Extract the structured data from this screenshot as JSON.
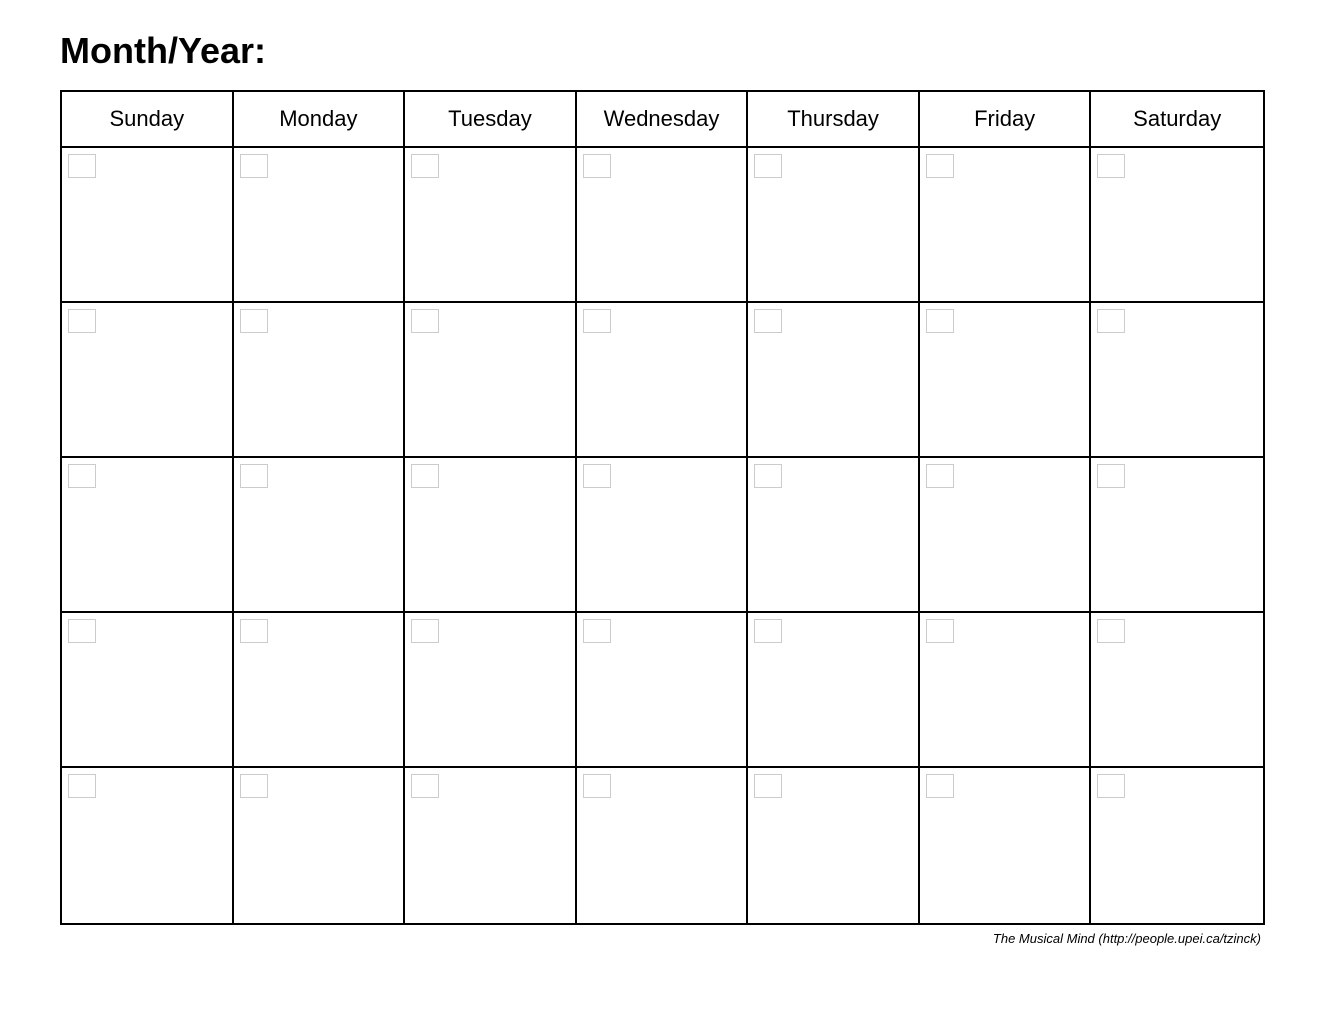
{
  "title": "Month/Year:",
  "days": [
    "Sunday",
    "Monday",
    "Tuesday",
    "Wednesday",
    "Thursday",
    "Friday",
    "Saturday"
  ],
  "weeks": 5,
  "footer": "The Musical Mind   (http://people.upei.ca/tzinck)"
}
